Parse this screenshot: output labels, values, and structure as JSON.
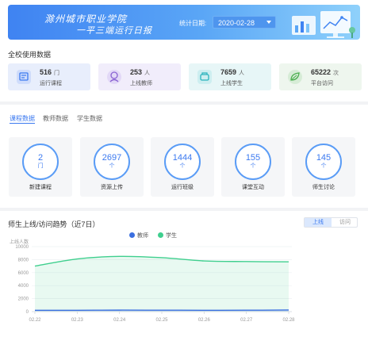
{
  "banner": {
    "title1": "滁州城市职业学院",
    "title2": "一平三端运行日报",
    "date_label": "统计日期:",
    "date_value": "2020-02-28",
    "colors": {
      "start": "#3f83f2",
      "end": "#8fd1fb"
    }
  },
  "school_stats": {
    "title": "全校使用数据",
    "items": [
      {
        "value": "516",
        "unit": "门",
        "label": "运行课程",
        "icon": "book-icon",
        "bg": "#e8eefc",
        "color": "#3b79f0"
      },
      {
        "value": "253",
        "unit": "人",
        "label": "上线教师",
        "icon": "teacher-icon",
        "bg": "#f1edfb",
        "color": "#8a63d2"
      },
      {
        "value": "7659",
        "unit": "人",
        "label": "上线学生",
        "icon": "student-icon",
        "bg": "#e7f6f7",
        "color": "#29b3bd"
      },
      {
        "value": "65222",
        "unit": "次",
        "label": "平台访问",
        "icon": "leaf-icon",
        "bg": "#eef6ee",
        "color": "#4caf50"
      }
    ]
  },
  "tabs": [
    {
      "label": "课程数据",
      "active": true
    },
    {
      "label": "教师数据",
      "active": false
    },
    {
      "label": "学生数据",
      "active": false
    }
  ],
  "course_cards": [
    {
      "value": "2",
      "unit": "门",
      "label": "新建课程"
    },
    {
      "value": "2697",
      "unit": "个",
      "label": "资源上传"
    },
    {
      "value": "1444",
      "unit": "个",
      "label": "运行班级"
    },
    {
      "value": "155",
      "unit": "个",
      "label": "课堂互动"
    },
    {
      "value": "145",
      "unit": "个",
      "label": "师生讨论"
    }
  ],
  "trend": {
    "title": "师生上线/访问趋势（近7日）",
    "toggle": {
      "option1": "上线",
      "option2": "访问",
      "active": "上线"
    }
  },
  "chart_data": {
    "type": "area",
    "ylabel": "上线人数",
    "ylim": [
      0,
      10000
    ],
    "yticks": [
      0,
      2000,
      4000,
      6000,
      8000,
      10000
    ],
    "x": [
      "02.22",
      "02.23",
      "02.24",
      "02.25",
      "02.26",
      "02.27",
      "02.28"
    ],
    "series": [
      {
        "name": "教师",
        "color": "#3b6fe0",
        "values": [
          200,
          210,
          230,
          220,
          210,
          215,
          253
        ]
      },
      {
        "name": "学生",
        "color": "#3fcf8e",
        "values": [
          7000,
          8100,
          8500,
          8300,
          7800,
          7700,
          7659
        ]
      }
    ],
    "grid": true,
    "legend": "top-center"
  }
}
